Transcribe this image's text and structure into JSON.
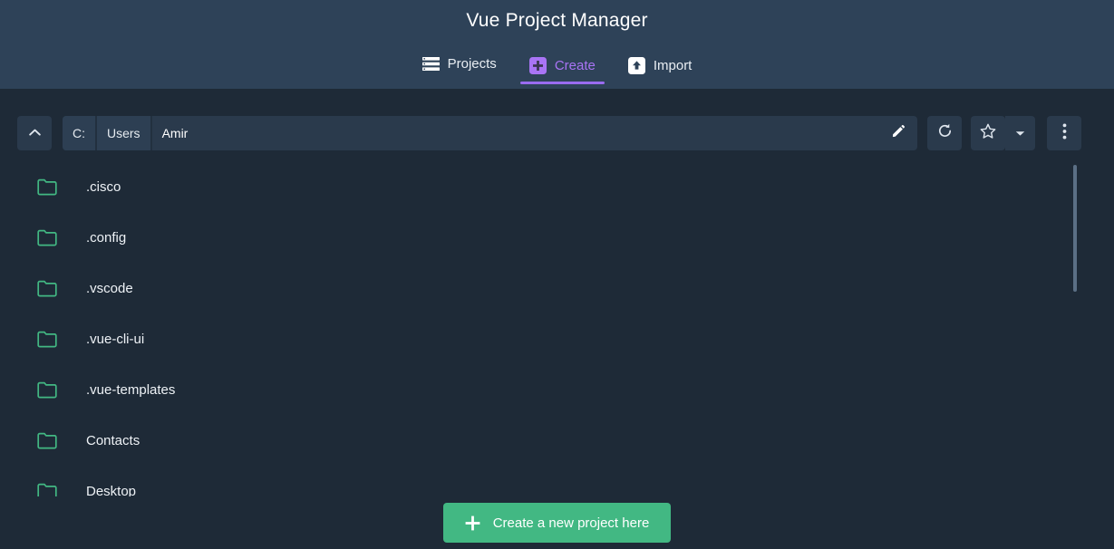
{
  "header": {
    "title": "Vue Project Manager",
    "tabs": [
      {
        "label": "Projects",
        "icon": "list-icon",
        "active": false
      },
      {
        "label": "Create",
        "icon": "plus-square-icon",
        "active": true
      },
      {
        "label": "Import",
        "icon": "import-icon",
        "active": false
      }
    ],
    "active_tab_color": "#9a6cf0"
  },
  "toolbar": {
    "up_button": "chevron-up-icon",
    "path_segments": [
      "C:",
      "Users"
    ],
    "current_path": "Amir",
    "edit_icon": "pencil-icon",
    "refresh_icon": "refresh-icon",
    "favorite_icon": "star-icon",
    "favorite_caret_icon": "caret-down-icon",
    "more_icon": "more-vertical-icon"
  },
  "filelist": {
    "folder_icon": "folder-icon",
    "items": [
      {
        "name": ".cisco"
      },
      {
        "name": ".config"
      },
      {
        "name": ".vscode"
      },
      {
        "name": ".vue-cli-ui"
      },
      {
        "name": ".vue-templates"
      },
      {
        "name": "Contacts"
      },
      {
        "name": "Desktop"
      }
    ]
  },
  "footer": {
    "create_label": "Create a new project here",
    "create_icon": "plus-icon",
    "create_color": "#42b883"
  },
  "colors": {
    "header_bg": "#2e4258",
    "body_bg": "#1e2a37",
    "control_bg": "#2a3a4c",
    "folder_green": "#42b883",
    "accent_purple": "#9a6cf0"
  }
}
